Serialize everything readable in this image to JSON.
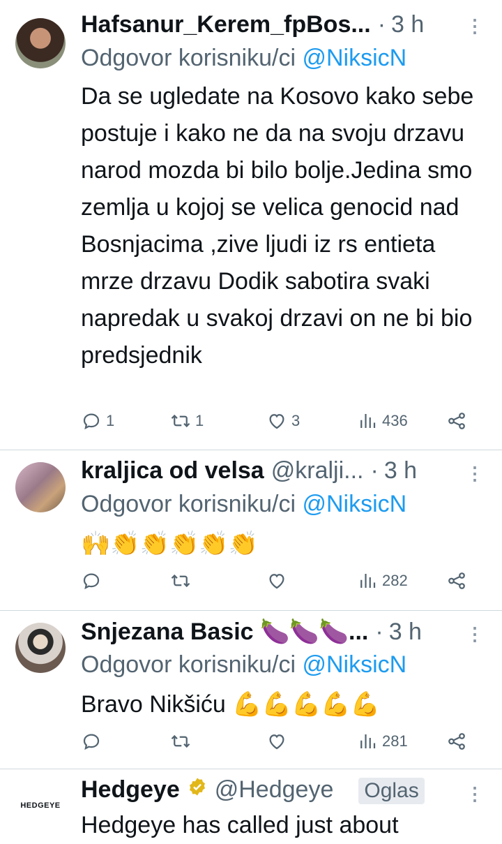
{
  "tweets": [
    {
      "name": "Hafsanur_Kerem_fpBos...",
      "handle": "",
      "time": "3 h",
      "reply_prefix": "Odgovor korisniku/ci",
      "reply_to": "@NiksicN",
      "text": "Da se ugledate na Kosovo kako sebe postuje i kako ne da na svoju drzavu narod mozda bi bilo bolje.Jedina smo zemlja u kojoj se velica genocid nad Bosnjacima ,zive ljudi iz rs entieta mrze drzavu Dodik sabotira svaki napredak u svakoj drzavi on ne bi bio predsjednik",
      "replies": "1",
      "retweets": "1",
      "likes": "3",
      "views": "436"
    },
    {
      "name": "kraljica od velsa",
      "handle": "@kralji...",
      "time": "3 h",
      "reply_prefix": "Odgovor korisniku/ci",
      "reply_to": "@NiksicN",
      "text": "🙌👏👏👏👏👏",
      "replies": "",
      "retweets": "",
      "likes": "",
      "views": "282"
    },
    {
      "name": "Snjezana Basic 🍆🍆🍆...",
      "handle": "",
      "time": "3 h",
      "reply_prefix": "Odgovor korisniku/ci",
      "reply_to": "@NiksicN",
      "text": "Bravo Nikšiću 💪💪💪💪💪",
      "replies": "",
      "retweets": "",
      "likes": "",
      "views": "281"
    },
    {
      "name": "Hedgeye",
      "handle": "@Hedgeye",
      "ad_label": "Oglas",
      "avatar_text": "HEDGEYE",
      "text": "Hedgeye has called just about"
    }
  ],
  "icons": {
    "reply": "reply-icon",
    "retweet": "retweet-icon",
    "like": "heart-icon",
    "views": "views-icon",
    "share": "share-icon",
    "more": "more-icon",
    "verified": "verified-badge-icon"
  },
  "colors": {
    "link": "#1d9bf0",
    "muted": "#536471",
    "verified": "#e2b719"
  }
}
